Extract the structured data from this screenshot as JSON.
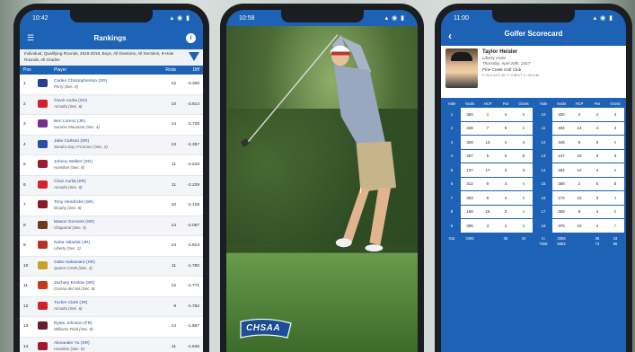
{
  "phone1": {
    "status_time": "10:42",
    "status_icons": "▴ ◉ ▮",
    "title": "Rankings",
    "filter_text": "Individual, Qualifying Rounds, 2016-2018, Boys, All Divisions, All Sections, 9-Hole Rounds, All Grades",
    "headers": {
      "pos": "Pos",
      "player": "Player",
      "rnds": "Rnds",
      "diff": "Diff"
    },
    "rows": [
      {
        "pos": "1",
        "name": "Caden Christopherson (SR)",
        "school": "Perry (Sec. 8)",
        "rnds": "12",
        "diff": "-3.300",
        "color": "#2a3f8f"
      },
      {
        "pos": "2",
        "name": "Gavin Aurlia (SO)",
        "school": "Arcadia (Sec. 6)",
        "rnds": "10",
        "diff": "-3.814",
        "color": "#d2232a"
      },
      {
        "pos": "3",
        "name": "Ben Lorenz (JR)",
        "school": "Sunrise Mountain (Sec. 4)",
        "rnds": "14",
        "diff": "-2.729",
        "color": "#7a2f8c"
      },
      {
        "pos": "4",
        "name": "Jake Carlson (SR)",
        "school": "Sandra Day O'Connor (Sec. 2)",
        "rnds": "13",
        "diff": "-2.357",
        "color": "#2a4fa8"
      },
      {
        "pos": "5",
        "name": "Johnny Walker (SO)",
        "school": "Hamilton (Sec. 8)",
        "rnds": "11",
        "diff": "-2.243",
        "color": "#a1192c"
      },
      {
        "pos": "6",
        "name": "Chaz Aurlia (SR)",
        "school": "Arcadia (Sec. 6)",
        "rnds": "11",
        "diff": "-2.229",
        "color": "#d2232a"
      },
      {
        "pos": "7",
        "name": "Tony Hendricks (SR)",
        "school": "Brophy (Sec. 6)",
        "rnds": "10",
        "diff": "-2.128",
        "color": "#8a1b2a"
      },
      {
        "pos": "8",
        "name": "Mason Gorness (SR)",
        "school": "Chaparral (Sec. 5)",
        "rnds": "14",
        "diff": "-2.057",
        "color": "#6b3a1f"
      },
      {
        "pos": "9",
        "name": "Noba Valadok (JR)",
        "school": "Liberty (Sec. 2)",
        "rnds": "14",
        "diff": "-1.814",
        "color": "#b2332a"
      },
      {
        "pos": "10",
        "name": "Gabe Salvanara (SR)",
        "school": "Queen Creek (Sec. 3)",
        "rnds": "11",
        "diff": "-1.780",
        "color": "#c9a224"
      },
      {
        "pos": "11",
        "name": "Zachary Enslow (SR)",
        "school": "Corona del Sol (Sec. 8)",
        "rnds": "12",
        "diff": "-1.771",
        "color": "#c33a1f"
      },
      {
        "pos": "12",
        "name": "Tucker Clark (JR)",
        "school": "Arcadia (Sec. 6)",
        "rnds": "8",
        "diff": "-1.762",
        "color": "#d2232a"
      },
      {
        "pos": "13",
        "name": "Rylan Johnson (FR)",
        "school": "Williams Field (Sec. 8)",
        "rnds": "14",
        "diff": "-1.657",
        "color": "#6a1a2a"
      },
      {
        "pos": "14",
        "name": "Alexander Yu (SR)",
        "school": "Hamilton (Sec. 8)",
        "rnds": "11",
        "diff": "-1.645",
        "color": "#a1192c"
      }
    ]
  },
  "phone2": {
    "status_time": "10:58",
    "status_icons": "▴ ◉ ▮",
    "logo_text": "CHSAA"
  },
  "phone3": {
    "status_time": "11:00",
    "status_icons": "▴ ◉ ▮",
    "title": "Golfer Scorecard",
    "player_name": "Taylor Heisler",
    "school": "Liberty Invite",
    "date": "Thursday, April 20th, 2017",
    "course": "Pine Creek Golf Club",
    "note": "P: 54 # 24 R 16 / T: 4 NEXT: 6 / 40 8 48",
    "headers": [
      "Hole",
      "Yards",
      "HCP",
      "Par",
      "Gross"
    ],
    "front": [
      [
        "1",
        "300",
        "1",
        "4",
        "5"
      ],
      [
        "2",
        "348",
        "7",
        "5",
        "6"
      ],
      [
        "3",
        "328",
        "13",
        "4",
        "4"
      ],
      [
        "4",
        "457",
        "5",
        "5",
        "5"
      ],
      [
        "5",
        "137",
        "17",
        "3",
        "3"
      ],
      [
        "6",
        "312",
        "9",
        "4",
        "5"
      ],
      [
        "7",
        "303",
        "9",
        "4",
        "5"
      ],
      [
        "8",
        "169",
        "15",
        "3",
        "4"
      ],
      [
        "9",
        "395",
        "3",
        "4",
        "6"
      ]
    ],
    "back": [
      [
        "10",
        "330",
        "4",
        "4",
        "4"
      ],
      [
        "11",
        "334",
        "14",
        "4",
        "4"
      ],
      [
        "12",
        "445",
        "6",
        "5",
        "6"
      ],
      [
        "13",
        "147",
        "18",
        "3",
        "3"
      ],
      [
        "14",
        "264",
        "12",
        "4",
        "5"
      ],
      [
        "15",
        "358",
        "2",
        "5",
        "5"
      ],
      [
        "16",
        "172",
        "10",
        "3",
        "4"
      ],
      [
        "17",
        "358",
        "8",
        "4",
        "5"
      ],
      [
        "18",
        "376",
        "16",
        "4",
        "7"
      ]
    ],
    "totals_front": [
      "Out",
      "3493",
      "",
      "36",
      "44"
    ],
    "totals_back": [
      "In",
      "3356",
      "",
      "36",
      "43"
    ],
    "totals_extra": [
      "Total",
      "6862",
      "",
      "72",
      "86"
    ]
  }
}
